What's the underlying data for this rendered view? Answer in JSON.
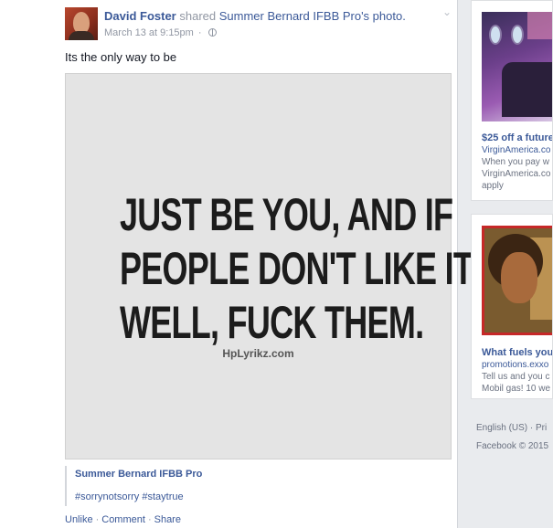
{
  "post": {
    "author": "David Foster",
    "shared_text": "shared",
    "source": "Summer Bernard IFBB Pro's photo.",
    "timestamp": "March 13 at 9:15pm",
    "dot": "·",
    "status_text": "Its the only way to be",
    "photo_quote": [
      "JUST BE YOU, AND IF",
      "PEOPLE DON'T LIKE IT,",
      "WELL, FUCK THEM."
    ],
    "photo_watermark": "HpLyrikz.com",
    "attribution_page": "Summer Bernard IFBB Pro",
    "hashtags": "#sorrynotsorry #staytrue",
    "actions": {
      "unlike": "Unlike",
      "comment": "Comment",
      "share": "Share",
      "sep": "·"
    }
  },
  "sidebar": {
    "ad1": {
      "title": "$25 off a future",
      "link": "VirginAmerica.co",
      "body1": "When you pay w",
      "body2": "VirginAmerica.co",
      "body3": "apply"
    },
    "ad2": {
      "title": "What fuels you",
      "link": "promotions.exxo",
      "body1": "Tell us and you c",
      "body2": "Mobil gas! 10 we"
    },
    "footer": {
      "language": "English (US) · Pri",
      "copyright": "Facebook © 2015"
    }
  },
  "icons": {
    "globe": "globe-icon",
    "chevron": "chevron-down-icon"
  }
}
